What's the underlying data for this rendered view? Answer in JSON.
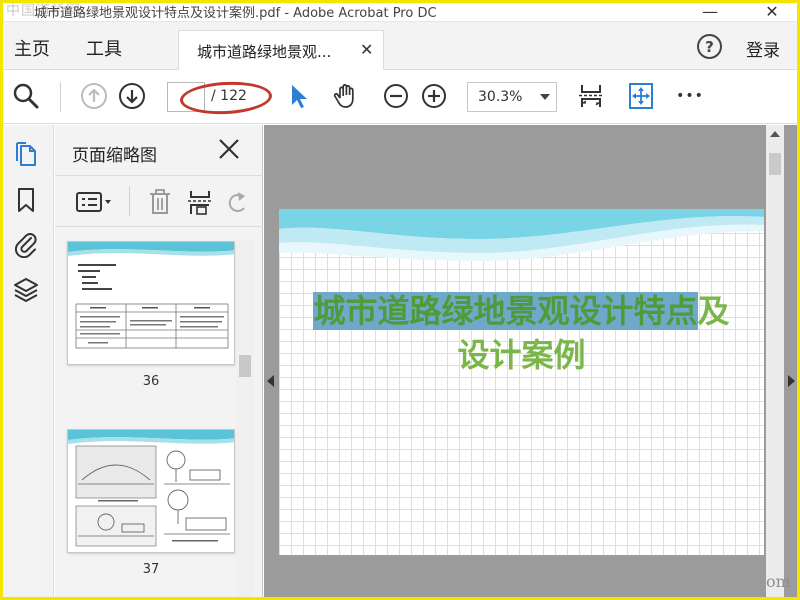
{
  "titlebar": {
    "title": "城市道路绿地景观设计特点及设计案例.pdf - Adobe Acrobat Pro DC",
    "watermark": "中国道桥网",
    "minimize": "—",
    "close": "✕"
  },
  "menubar": {
    "home": "主页",
    "tools": "工具",
    "tab_label": "城市道路绿地景观...",
    "tab_close": "✕",
    "help": "?",
    "login": "登录"
  },
  "toolbar": {
    "page_input_value": "",
    "page_total": "/ 122",
    "zoom": "30.3%",
    "more": "•••"
  },
  "thumbnail_panel": {
    "title": "页面缩略图",
    "pages": [
      {
        "number": "36"
      },
      {
        "number": "37"
      }
    ]
  },
  "document": {
    "slide_title_line1_highlighted": "城市道路绿地景观设计特点",
    "slide_title_line1_rest": "及",
    "slide_title_line2": "设计案例"
  },
  "corner_mark": "om",
  "colors": {
    "frame": "#f2e600",
    "accent_blue": "#2d7fd6",
    "annotation_red": "#c0392b",
    "title_green": "#7ab648",
    "highlight": "#6fa9c9"
  }
}
